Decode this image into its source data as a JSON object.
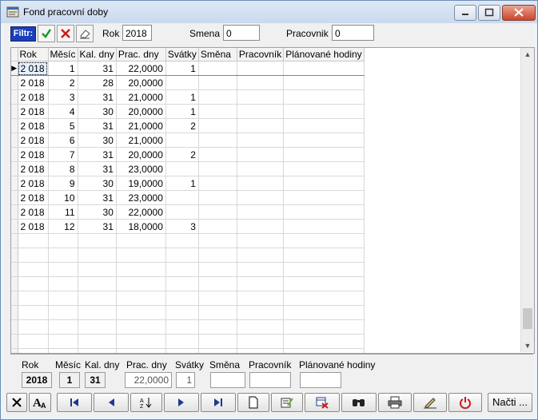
{
  "window": {
    "title": "Fond pracovní doby"
  },
  "filter_bar": {
    "filter_label": "Filtr:",
    "rok_label": "Rok",
    "rok_value": "2018",
    "smena_label": "Smena",
    "smena_value": "0",
    "pracovnik_label": "Pracovnik",
    "pracovnik_value": "0"
  },
  "grid": {
    "columns": [
      "Rok",
      "Měsíc",
      "Kal. dny",
      "Prac. dny",
      "Svátky",
      "Směna",
      "Pracovník",
      "Plánované hodiny"
    ],
    "rows": [
      [
        "2 018",
        "1",
        "31",
        "22,0000",
        "1",
        "",
        "",
        ""
      ],
      [
        "2 018",
        "2",
        "28",
        "20,0000",
        "",
        "",
        "",
        ""
      ],
      [
        "2 018",
        "3",
        "31",
        "21,0000",
        "1",
        "",
        "",
        ""
      ],
      [
        "2 018",
        "4",
        "30",
        "20,0000",
        "1",
        "",
        "",
        ""
      ],
      [
        "2 018",
        "5",
        "31",
        "21,0000",
        "2",
        "",
        "",
        ""
      ],
      [
        "2 018",
        "6",
        "30",
        "21,0000",
        "",
        "",
        "",
        ""
      ],
      [
        "2 018",
        "7",
        "31",
        "20,0000",
        "2",
        "",
        "",
        ""
      ],
      [
        "2 018",
        "8",
        "31",
        "23,0000",
        "",
        "",
        "",
        ""
      ],
      [
        "2 018",
        "9",
        "30",
        "19,0000",
        "1",
        "",
        "",
        ""
      ],
      [
        "2 018",
        "10",
        "31",
        "23,0000",
        "",
        "",
        "",
        ""
      ],
      [
        "2 018",
        "11",
        "30",
        "22,0000",
        "",
        "",
        "",
        ""
      ],
      [
        "2 018",
        "12",
        "31",
        "18,0000",
        "3",
        "",
        "",
        ""
      ]
    ],
    "selected_row": 0
  },
  "detail": {
    "labels": {
      "rok": "Rok",
      "mesic": "Měsíc",
      "kal_dny": "Kal. dny",
      "prac_dny": "Prac. dny",
      "svatky": "Svátky",
      "smena": "Směna",
      "pracovnik": "Pracovník",
      "planovane": "Plánované hodiny"
    },
    "values": {
      "rok": "2018",
      "mesic": "1",
      "kal_dny": "31",
      "prac_dny": "22,0000",
      "svatky": "1",
      "smena": "",
      "pracovnik": "",
      "planovane": ""
    }
  },
  "toolbar": {
    "load_label": "Načti ..."
  },
  "icons": [
    "window-app-icon",
    "check-icon",
    "cross-icon",
    "eraser-icon",
    "close-x-icon",
    "font-icon",
    "first-record-icon",
    "prev-record-icon",
    "sort-icon",
    "next-record-icon",
    "last-record-icon",
    "new-document-icon",
    "edit-icon",
    "delete-icon",
    "binoculars-icon",
    "printer-icon",
    "pencil-icon",
    "power-icon"
  ]
}
